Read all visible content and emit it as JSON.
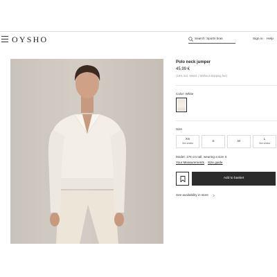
{
  "header": {
    "logo": "OYSHO",
    "search_text": "Search: Sports bras",
    "sign_in": "Sign in",
    "help": "Help"
  },
  "product": {
    "title": "Polo neck jumper",
    "price": "45,99 €",
    "vat_note": "(19% incl. MwSt. / Without shipping fee)",
    "color_label": "Color: White",
    "size_label": "Size",
    "sizes": [
      {
        "label": "XS",
        "sub": "See similar"
      },
      {
        "label": "S",
        "sub": ""
      },
      {
        "label": "M",
        "sub": ""
      },
      {
        "label": "L",
        "sub": "See similar"
      }
    ],
    "model_info": "Model: 176 cm tall, wearing a size S",
    "your_measurements": "Your Measurements",
    "size_guide": "Size guide",
    "add_to_basket": "Add to basket",
    "availability": "See availability in store"
  },
  "icons": [
    "menu-icon",
    "search-icon",
    "bookmark-icon",
    "chevron-right-icon"
  ],
  "colors": {
    "text": "#222222",
    "button_bg": "#2b2b2b",
    "button_text": "#ffffff",
    "photo_bg": "#cdc7c0",
    "garment": "#f2eee6"
  }
}
